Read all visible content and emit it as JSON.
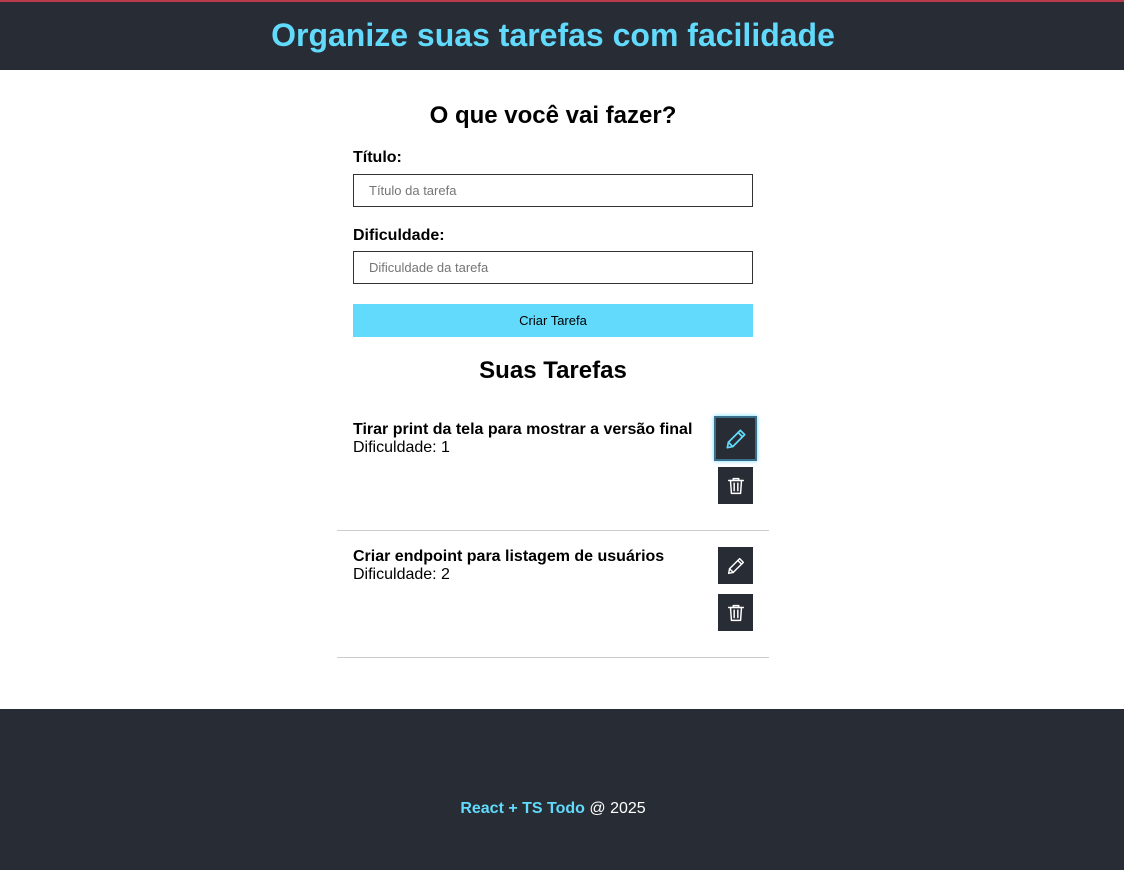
{
  "header": {
    "title": "Organize suas tarefas com facilidade"
  },
  "form": {
    "title": "O que você vai fazer?",
    "title_label": "Título:",
    "title_placeholder": "Título da tarefa",
    "title_value": "",
    "difficulty_label": "Dificuldade:",
    "difficulty_placeholder": "Dificuldade da tarefa",
    "difficulty_value": "",
    "submit_label": "Criar Tarefa"
  },
  "list": {
    "title": "Suas Tarefas",
    "difficulty_prefix": "Dificuldade:",
    "tasks": [
      {
        "name": "Tirar print da tela para mostrar a versão final",
        "difficulty": "Dificuldade: 1",
        "edit_icon": "pencil-icon",
        "delete_icon": "trash-icon"
      },
      {
        "name": "Criar endpoint para listagem de usuários",
        "difficulty": "Dificuldade: 2",
        "edit_icon": "pencil-icon",
        "delete_icon": "trash-icon"
      }
    ]
  },
  "footer": {
    "brand": "React + TS Todo",
    "suffix": " @ 2025"
  },
  "colors": {
    "dark": "#282c34",
    "accent": "#61dafb",
    "divider": "#cccccc"
  }
}
